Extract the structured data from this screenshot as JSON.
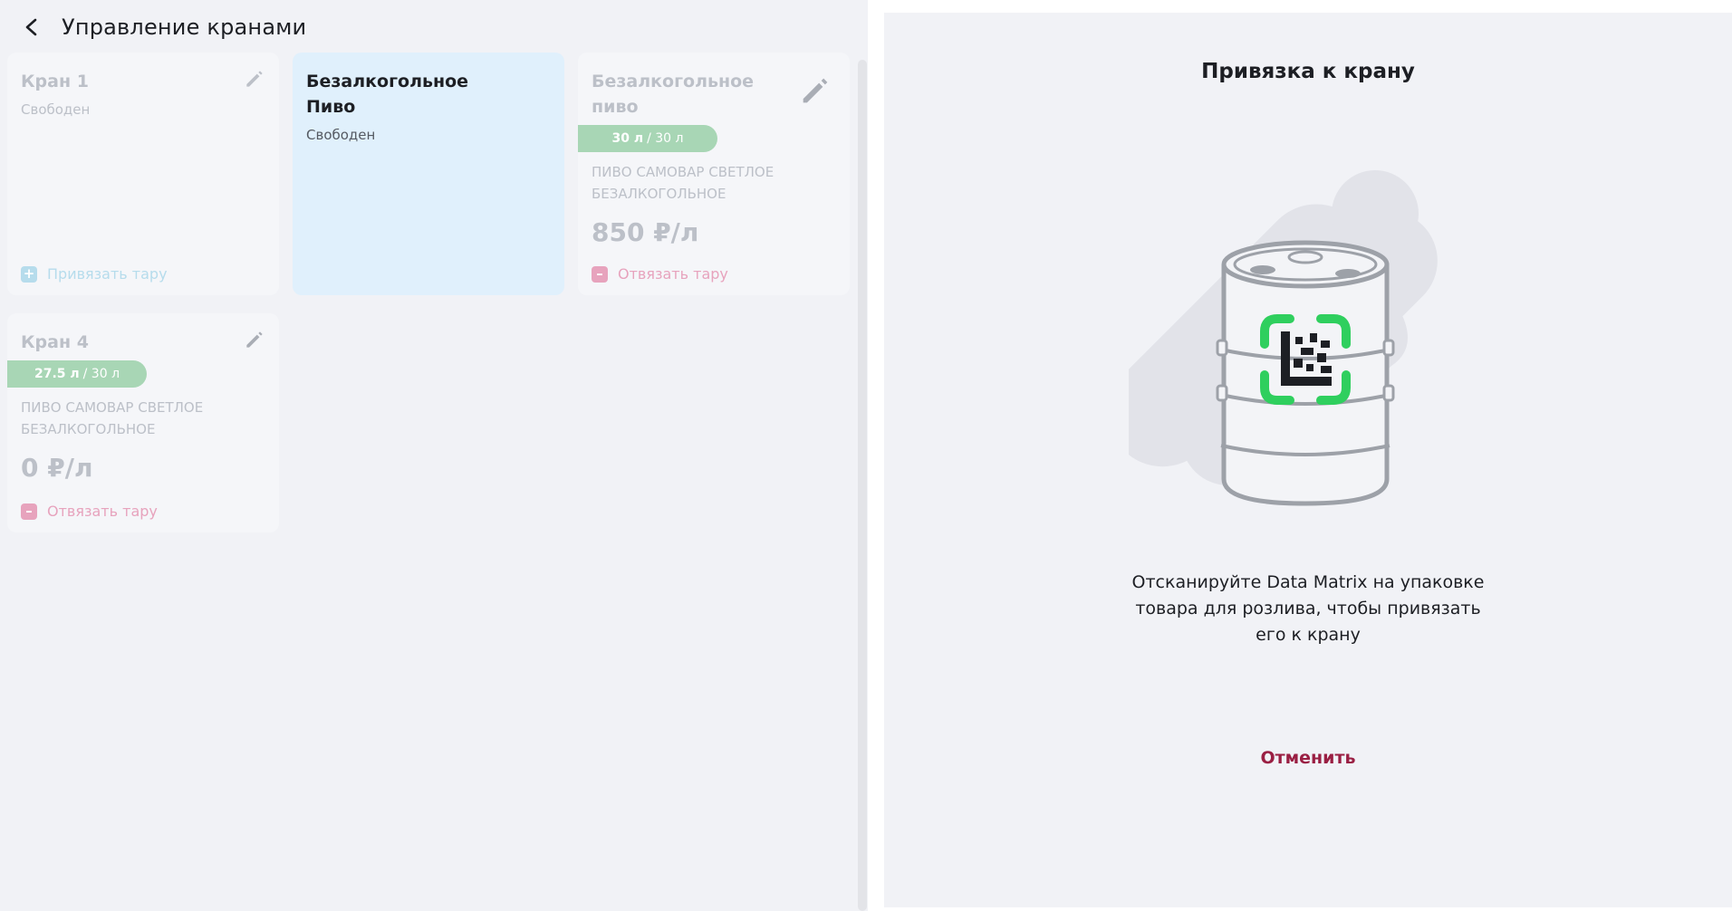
{
  "header": {
    "title": "Управление кранами"
  },
  "taps": [
    {
      "title": "Кран 1",
      "status": "Свободен",
      "action_label": "Привязать тару"
    },
    {
      "title": "Безалкогольное Пиво",
      "status": "Свободен"
    },
    {
      "title": "Безалкогольное пиво",
      "volume_current": "30 л",
      "volume_total": "/ 30 л",
      "fill_fraction": 1.0,
      "product": "ПИВО САМОВАР СВЕТЛОЕ БЕЗАЛКОГОЛЬНОЕ",
      "price": "850 ₽/л",
      "action_label": "Отвязать тару"
    },
    {
      "title": "Кран 4",
      "volume_current": "27.5 л",
      "volume_total": "/ 30 л",
      "fill_fraction": 0.917,
      "product": "ПИВО САМОВАР СВЕТЛОЕ БЕЗАЛКОГОЛЬНОЕ",
      "price": "0 ₽/л",
      "action_label": "Отвязать тару"
    }
  ],
  "modal": {
    "title": "Привязка к крану",
    "instruction": "Отсканируйте Data Matrix на упаковке товара для розлива, чтобы привязать его к крану",
    "cancel_label": "Отменить",
    "illustration_icon": "keg-datamatrix-icon"
  },
  "colors": {
    "accent_cancel": "#9a1f43",
    "active_card": "#e0f0fc",
    "volume_badge": "#a8d6b5",
    "unbind": "#e7a3bd",
    "bind": "#b6dcec",
    "scan_frame": "#2fcf5e"
  }
}
